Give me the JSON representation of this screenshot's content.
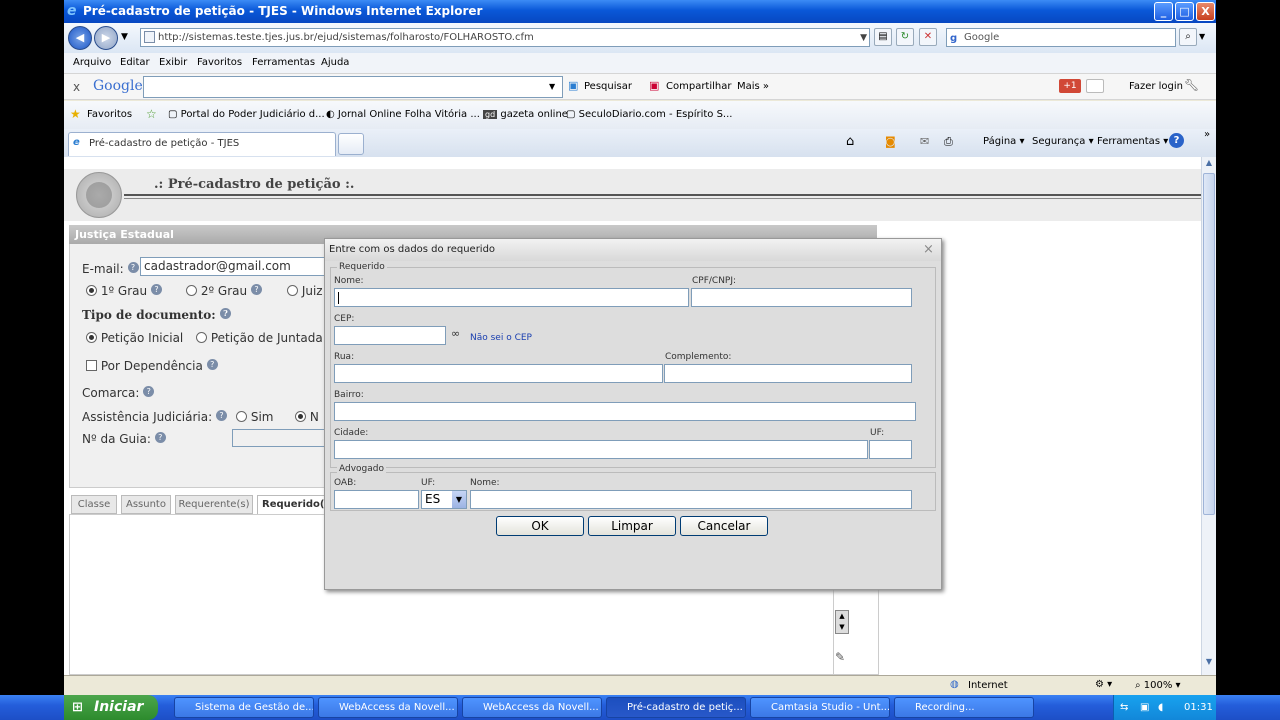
{
  "window": {
    "title": "Pré-cadastro de petição - TJES - Windows Internet Explorer",
    "min": "_",
    "max": "□",
    "close": "X"
  },
  "address": {
    "url": "http://sistemas.teste.tjes.jus.br/ejud/sistemas/folharosto/FOLHAROSTO.cfm",
    "search_placeholder": "Google"
  },
  "menu": [
    "Arquivo",
    "Editar",
    "Exibir",
    "Favoritos",
    "Ferramentas",
    "Ajuda"
  ],
  "google_bar": {
    "close": "x",
    "logo": "Google",
    "search": "Pesquisar",
    "share": "Compartilhar",
    "more": "Mais »",
    "login": "Fazer login",
    "plus": "+1"
  },
  "favorites": {
    "label": "Favoritos",
    "items": [
      "Portal do Poder Judiciário d...",
      "Jornal Online Folha Vitória ...",
      "gazeta online",
      "SeculoDiario.com - Espírito S..."
    ]
  },
  "tab": {
    "label": "Pré-cadastro de petição - TJES",
    "tools": [
      "Página",
      "Segurança",
      "Ferramentas"
    ]
  },
  "page": {
    "title": ".: Pré-cadastro de petição :.",
    "panel_title": "Justiça Estadual",
    "email_label": "E-mail:",
    "email_value": "cadastrador@gmail.com",
    "grau1": "1º Grau",
    "grau2": "2º Grau",
    "grau3": "Juiz",
    "tipo_label": "Tipo de documento:",
    "peticao_inicial": "Petição Inicial",
    "peticao_juntada": "Petição de Juntada",
    "por_dependencia": "Por Dependência",
    "comarca": "Comarca:",
    "assistencia": "Assistência Judiciária:",
    "sim": "Sim",
    "nao": "N",
    "guia": "Nº da Guia:",
    "tabs": [
      "Classe",
      "Assunto",
      "Requerente(s)",
      "Requerido("
    ]
  },
  "dialog": {
    "title": "Entre com os dados do requerido",
    "close": "×",
    "requerido_legend": "Requerido",
    "nome": "Nome:",
    "cpf": "CPF/CNPJ:",
    "cep": "CEP:",
    "nao_sei_cep": "Não sei o CEP",
    "rua": "Rua:",
    "complemento": "Complemento:",
    "bairro": "Bairro:",
    "cidade": "Cidade:",
    "uf": "UF:",
    "advogado_legend": "Advogado",
    "oab": "OAB:",
    "uf2": "UF:",
    "uf_value": "ES",
    "nome2": "Nome:",
    "ok": "OK",
    "limpar": "Limpar",
    "cancelar": "Cancelar"
  },
  "status": {
    "zone": "Internet",
    "zoom": "100%"
  },
  "taskbar": {
    "start": "Iniciar",
    "tasks": [
      "Sistema de Gestão de...",
      "WebAccess da Novell...",
      "WebAccess da Novell...",
      "Pré-cadastro de petiç...",
      "Camtasia Studio - Unt...",
      "Recording..."
    ],
    "clock": "01:31"
  }
}
